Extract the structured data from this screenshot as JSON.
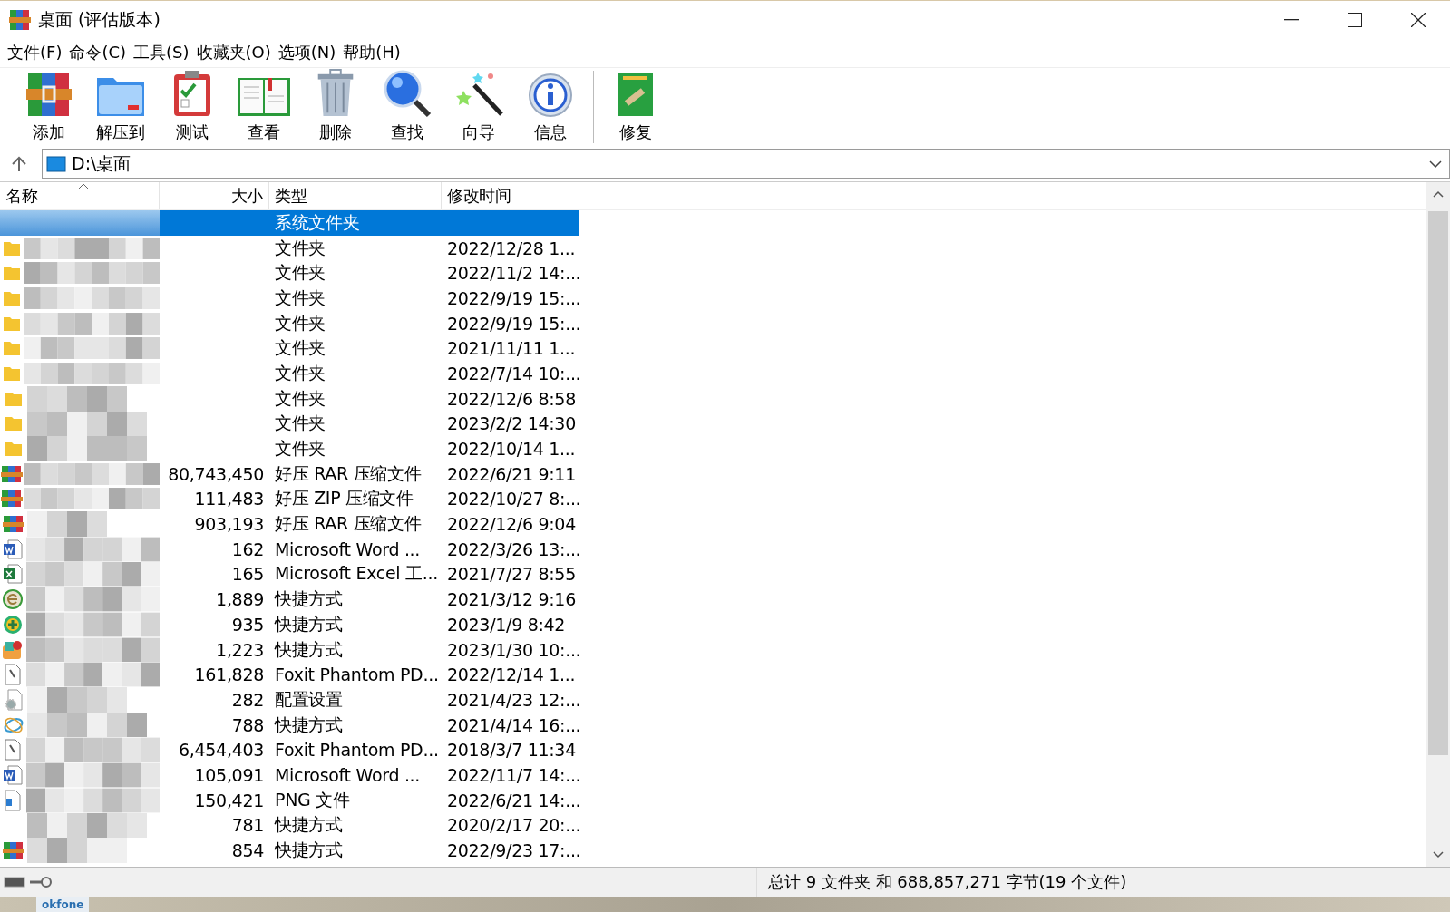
{
  "window": {
    "title": "桌面 (评估版本)"
  },
  "menu": [
    "文件(F)",
    "命令(C)",
    "工具(S)",
    "收藏夹(O)",
    "选项(N)",
    "帮助(H)"
  ],
  "toolbar": [
    {
      "kind": "add",
      "label": "添加"
    },
    {
      "kind": "extract",
      "label": "解压到"
    },
    {
      "kind": "test",
      "label": "测试"
    },
    {
      "kind": "view",
      "label": "查看"
    },
    {
      "kind": "delete",
      "label": "删除"
    },
    {
      "kind": "find",
      "label": "查找"
    },
    {
      "kind": "wizard",
      "label": "向导"
    },
    {
      "kind": "info",
      "label": "信息"
    },
    {
      "kind": "separator"
    },
    {
      "kind": "repair",
      "label": "修复"
    }
  ],
  "address": {
    "path": "D:\\桌面"
  },
  "columns": [
    {
      "label": "名称",
      "sorted": true
    },
    {
      "label": "大小",
      "sorted": false
    },
    {
      "label": "类型",
      "sorted": false
    },
    {
      "label": "修改时间",
      "sorted": false
    }
  ],
  "rows": [
    {
      "type": "系统文件夹",
      "selected": true
    },
    {
      "kind": "folder",
      "type": "文件夹",
      "modified": "2022/12/28 1...",
      "selected": false
    },
    {
      "kind": "folder",
      "type": "文件夹",
      "modified": "2022/11/2 14:...",
      "selected": false
    },
    {
      "kind": "folder",
      "type": "文件夹",
      "modified": "2022/9/19 15:...",
      "selected": false
    },
    {
      "kind": "folder",
      "type": "文件夹",
      "modified": "2022/9/19 15:...",
      "selected": false
    },
    {
      "kind": "folder",
      "type": "文件夹",
      "modified": "2021/11/11 1...",
      "selected": false
    },
    {
      "kind": "folder",
      "type": "文件夹",
      "modified": "2022/7/14 10:...",
      "selected": false
    },
    {
      "kind": "folder",
      "type": "文件夹",
      "modified": "2022/12/6 8:58",
      "selected": false
    },
    {
      "kind": "folder",
      "type": "文件夹",
      "modified": "2023/2/2 14:30",
      "selected": false
    },
    {
      "kind": "folder",
      "type": "文件夹",
      "modified": "2022/10/14 1...",
      "selected": false
    },
    {
      "kind": "archive",
      "size": "80,743,450",
      "type": "好压 RAR 压缩文件",
      "modified": "2022/6/21 9:11",
      "selected": false
    },
    {
      "kind": "archive",
      "size": "111,483",
      "type": "好压 ZIP 压缩文件",
      "modified": "2022/10/27 8:...",
      "selected": false
    },
    {
      "kind": "archive",
      "size": "903,193",
      "type": "好压 RAR 压缩文件",
      "modified": "2022/12/6 9:04",
      "selected": false
    },
    {
      "kind": "word",
      "size": "162",
      "type": "Microsoft Word ...",
      "modified": "2022/3/26 13:...",
      "selected": false
    },
    {
      "kind": "excel",
      "size": "165",
      "type": "Microsoft Excel 工...",
      "modified": "2021/7/27 8:55",
      "selected": false
    },
    {
      "kind": "globe",
      "size": "1,889",
      "type": "快捷方式",
      "modified": "2021/3/12 9:16",
      "selected": false
    },
    {
      "kind": "plus",
      "size": "935",
      "type": "快捷方式",
      "modified": "2023/1/9 8:42",
      "selected": false
    },
    {
      "kind": "app",
      "size": "1,223",
      "type": "快捷方式",
      "modified": "2023/1/30 10:...",
      "selected": false
    },
    {
      "kind": "pdf",
      "size": "161,828",
      "type": "Foxit Phantom PD...",
      "modified": "2022/12/14 1...",
      "selected": false
    },
    {
      "kind": "settings",
      "size": "282",
      "type": "配置设置",
      "modified": "2021/4/23 12:...",
      "selected": false
    },
    {
      "kind": "swirl",
      "size": "788",
      "type": "快捷方式",
      "modified": "2021/4/14 16:...",
      "selected": false
    },
    {
      "kind": "pdf",
      "size": "6,454,403",
      "type": "Foxit Phantom PD...",
      "modified": "2018/3/7 11:34",
      "selected": false
    },
    {
      "kind": "word",
      "size": "105,091",
      "type": "Microsoft Word ...",
      "modified": "2022/11/7 14:...",
      "selected": false
    },
    {
      "kind": "image",
      "size": "150,421",
      "type": "PNG 文件",
      "modified": "2022/6/21 14:...",
      "selected": false
    },
    {
      "size": "781",
      "type": "快捷方式",
      "modified": "2020/2/17 20:...",
      "selected": false
    },
    {
      "kind": "archive",
      "size": "854",
      "type": "快捷方式",
      "modified": "2022/9/23 17:...",
      "selected": false
    }
  ],
  "status_bar": {
    "text": "总计 9 文件夹 和 688,857,271 字节(19 个文件)"
  },
  "desktop": {
    "label": "okfone"
  }
}
